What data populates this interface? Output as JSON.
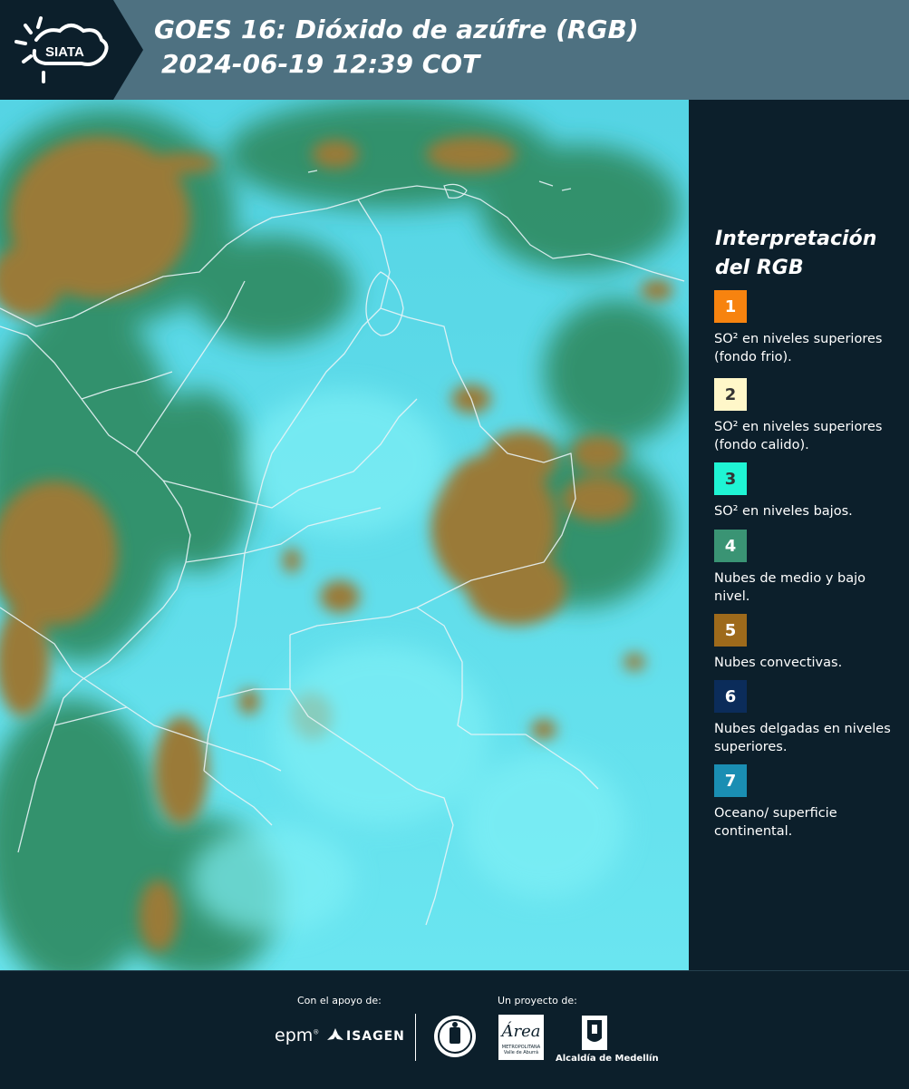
{
  "header": {
    "logo_text": "SIATA",
    "title_line1": "GOES 16: Dióxido de azúfre (RGB)",
    "title_line2": "2024-06-19 12:39 COT"
  },
  "legend": {
    "title_line1": "Interpretación",
    "title_line2": "del RGB",
    "items": [
      {
        "num": "1",
        "color": "#f7830f",
        "text": "SO² en niveles superiores (fondo frio)."
      },
      {
        "num": "2",
        "color": "#fff7c9",
        "text": "SO² en niveles superiores (fondo calido)."
      },
      {
        "num": "3",
        "color": "#1ff4d4",
        "text": "SO² en niveles bajos."
      },
      {
        "num": "4",
        "color": "#3a9474",
        "text": "Nubes de medio y bajo nivel."
      },
      {
        "num": "5",
        "color": "#9e6a1b",
        "text": "Nubes convectivas."
      },
      {
        "num": "6",
        "color": "#0b2c5a",
        "text": "Nubes delgadas en niveles superiores."
      },
      {
        "num": "7",
        "color": "#1a8eb3",
        "text": "Oceano/ superficie continental."
      }
    ]
  },
  "footer": {
    "support_label": "Con el apoyo de:",
    "project_label": "Un proyecto de:",
    "sponsor_epm": "epm",
    "sponsor_isagen": "ISAGEN",
    "area_logo": "Área",
    "area_sub1": "METROPOLITANA",
    "area_sub2": "Valle de Aburrá",
    "alcaldia": "Alcaldía de Medellín"
  },
  "colors": {
    "header_bg": "#4e7181",
    "page_bg": "#0c1f2b",
    "cloud_cyan": "#5fe0ee",
    "cloud_brown": "#9a7a3a",
    "cloud_green": "#2f8a66"
  }
}
